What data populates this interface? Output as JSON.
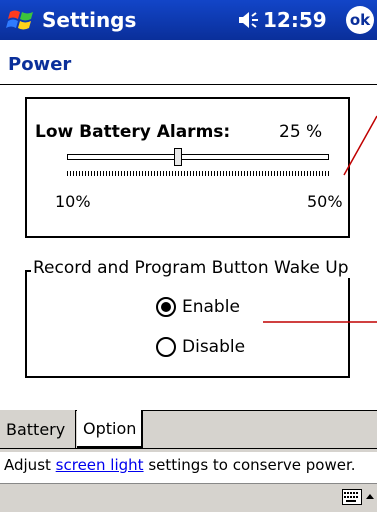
{
  "titlebar": {
    "app_title": "Settings",
    "clock": "12:59",
    "ok_label": "ok",
    "start_icon": "windows-flag-icon",
    "volume_icon": "speaker-icon",
    "color": "#0a2f9a"
  },
  "page": {
    "title": "Power"
  },
  "alarms": {
    "label": "Low Battery Alarms:",
    "value_text": "25 %",
    "min_label": "10%",
    "max_label": "50%",
    "slider_value_percent": 25,
    "slider_min": 10,
    "slider_max": 50
  },
  "wake": {
    "legend": "Record and Program Button Wake Up",
    "options": [
      {
        "label": "Enable",
        "selected": true
      },
      {
        "label": "Disable",
        "selected": false
      }
    ]
  },
  "tabs": [
    {
      "label": "Battery",
      "active": false
    },
    {
      "label": "Option",
      "active": true
    }
  ],
  "hint": {
    "prefix": "Adjust ",
    "link": "screen light",
    "suffix": " settings to conserve power."
  },
  "bottom": {
    "keyboard_icon": "keyboard-icon",
    "arrow_icon": "sip-up-arrow-icon"
  }
}
